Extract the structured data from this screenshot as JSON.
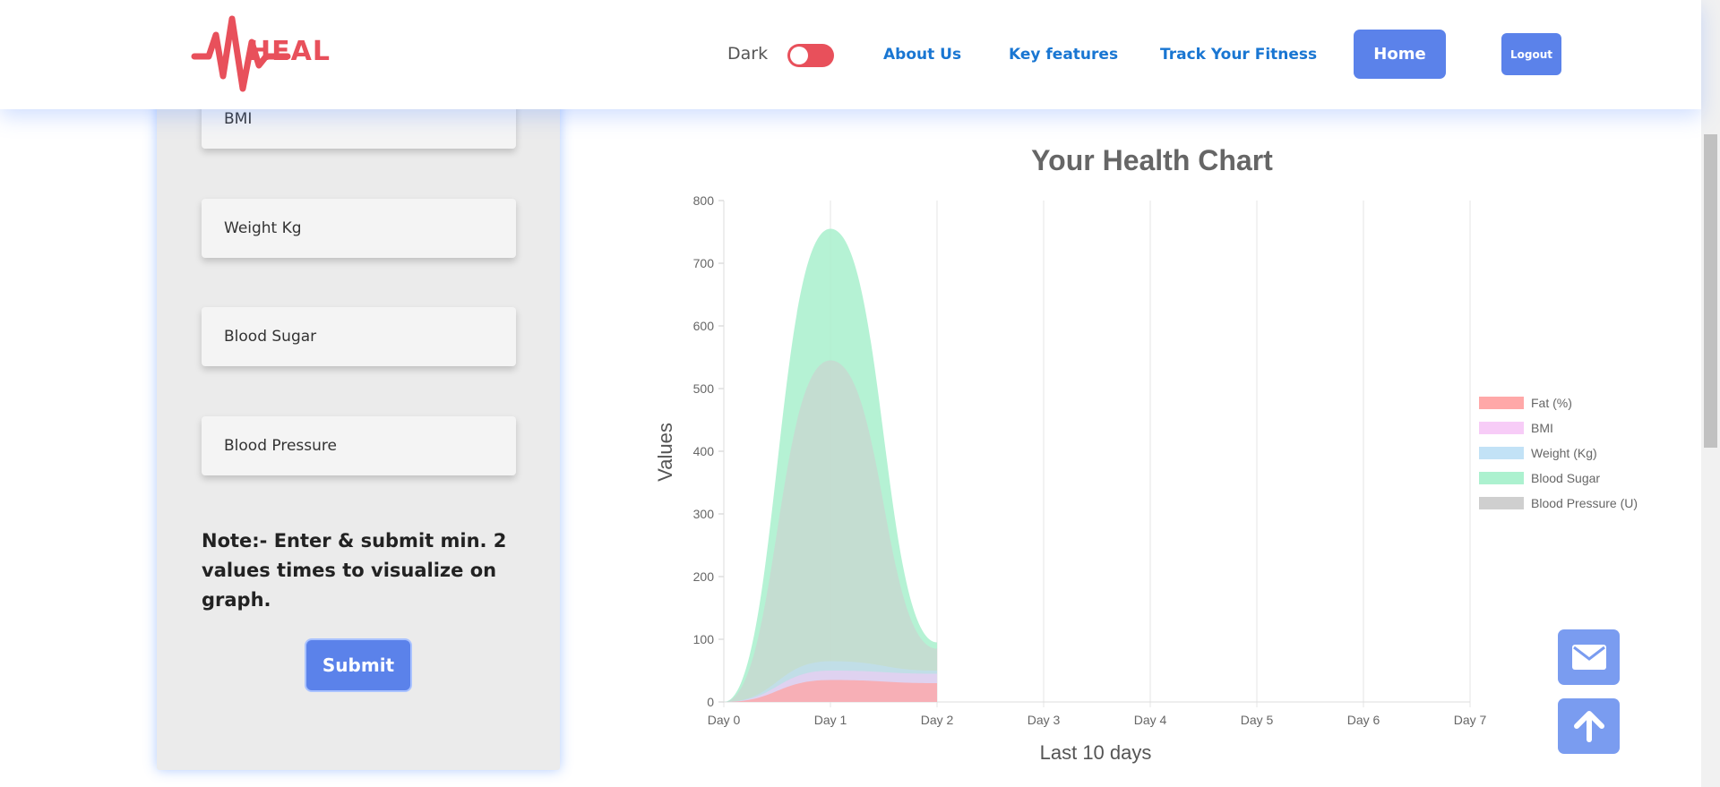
{
  "brand": {
    "name": "HEAL",
    "color": "#e8505b"
  },
  "header": {
    "dark_label": "Dark",
    "dark_mode_on": false,
    "nav": [
      "About Us",
      "Key features",
      "Track Your Fitness"
    ],
    "home_label": "Home",
    "logout_label": "Logout"
  },
  "form": {
    "fields": [
      {
        "placeholder": "BMI"
      },
      {
        "placeholder": "Weight Kg"
      },
      {
        "placeholder": "Blood Sugar"
      },
      {
        "placeholder": "Blood Pressure"
      }
    ],
    "note": "Note:- Enter & submit min. 2 values times to visualize on graph.",
    "submit_label": "Submit"
  },
  "colors": {
    "accent": "#5b82ea",
    "link": "#1976d2",
    "toggle": "#e8505b"
  },
  "floating": {
    "mail_icon": "envelope-icon",
    "up_icon": "arrow-up-icon"
  },
  "chart_data": {
    "type": "area",
    "title": "Your Health Chart",
    "xlabel": "Last 10 days",
    "ylabel": "Values",
    "categories": [
      "Day 0",
      "Day 1",
      "Day 2",
      "Day 3",
      "Day 4",
      "Day 5",
      "Day 6",
      "Day 7"
    ],
    "ylim": [
      0,
      800
    ],
    "yticks": [
      0,
      100,
      200,
      300,
      400,
      500,
      600,
      700,
      800
    ],
    "grid": true,
    "legend_position": "right",
    "series": [
      {
        "name": "Fat (%)",
        "values": [
          0,
          35,
          30
        ],
        "color": "#ffa3a3"
      },
      {
        "name": "BMI",
        "values": [
          0,
          50,
          45
        ],
        "color": "#f7c9f7"
      },
      {
        "name": "Weight (Kg)",
        "values": [
          0,
          65,
          50
        ],
        "color": "#bfe0f5"
      },
      {
        "name": "Blood Sugar",
        "values": [
          0,
          755,
          95
        ],
        "color": "#a8f0cc"
      },
      {
        "name": "Blood Pressure (U)",
        "values": [
          0,
          545,
          85
        ],
        "color": "#cfcfcf"
      }
    ]
  }
}
